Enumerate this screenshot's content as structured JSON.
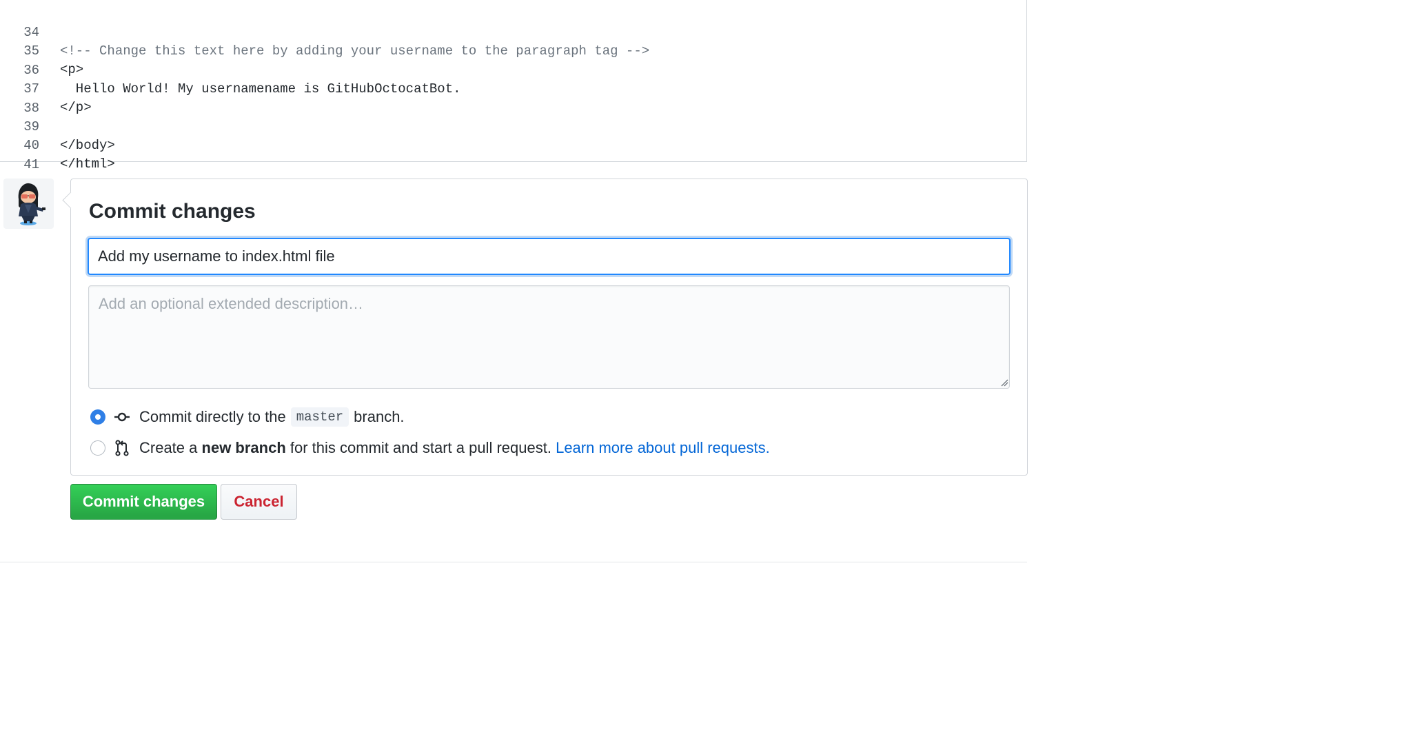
{
  "editor": {
    "lines": [
      {
        "num": "34",
        "code": "<!-- Change this text here by adding your username to the paragraph tag -->"
      },
      {
        "num": "35",
        "code": "<p>"
      },
      {
        "num": "36",
        "code": "  Hello World! My usernamename is GitHubOctocatBot."
      },
      {
        "num": "37",
        "code": "</p>"
      },
      {
        "num": "38",
        "code": ""
      },
      {
        "num": "39",
        "code": "</body>"
      },
      {
        "num": "40",
        "code": "</html>"
      },
      {
        "num": "41",
        "code": ""
      }
    ]
  },
  "commit": {
    "title": "Commit changes",
    "summary_value": "Add my username to index.html file",
    "description_placeholder": "Add an optional extended description…",
    "option_direct": {
      "prefix": "Commit directly to the",
      "branch": "master",
      "suffix": "branch.",
      "icon": "git-commit-icon",
      "selected": true
    },
    "option_new_branch": {
      "prefix": "Create a",
      "bold": "new branch",
      "suffix": "for this commit and start a pull request.",
      "link": "Learn more about pull requests.",
      "icon": "git-pull-request-icon",
      "selected": false
    }
  },
  "buttons": {
    "commit_label": "Commit changes",
    "cancel_label": "Cancel"
  },
  "colors": {
    "primary_green": "#28a745",
    "cancel_red": "#cb2431",
    "link_blue": "#0366d6",
    "focus_blue": "#2188ff"
  }
}
